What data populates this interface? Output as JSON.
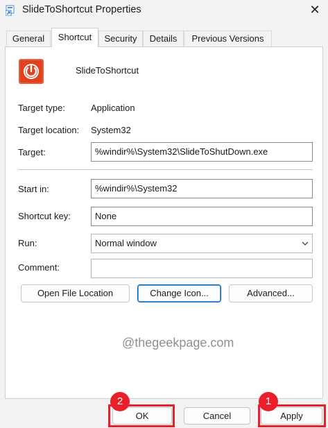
{
  "window": {
    "title": "SlideToShortcut Properties",
    "close_glyph": "✕"
  },
  "tabs": [
    {
      "label": "General"
    },
    {
      "label": "Shortcut"
    },
    {
      "label": "Security"
    },
    {
      "label": "Details"
    },
    {
      "label": "Previous Versions"
    }
  ],
  "shortcut": {
    "name": "SlideToShortcut",
    "icon": "power-icon",
    "target_type_label": "Target type:",
    "target_type": "Application",
    "target_location_label": "Target location:",
    "target_location": "System32",
    "target_label": "Target:",
    "target": "%windir%\\System32\\SlideToShutDown.exe",
    "start_in_label": "Start in:",
    "start_in": "%windir%\\System32",
    "shortcut_key_label": "Shortcut key:",
    "shortcut_key": "None",
    "run_label": "Run:",
    "run": "Normal window",
    "comment_label": "Comment:",
    "comment": ""
  },
  "buttons": {
    "open_file_location": "Open File Location",
    "change_icon": "Change Icon...",
    "advanced": "Advanced...",
    "ok": "OK",
    "cancel": "Cancel",
    "apply": "Apply"
  },
  "watermark": "@thegeekpage.com",
  "annotations": {
    "ok_badge": "2",
    "apply_badge": "1"
  },
  "colors": {
    "accent": "#0067c0",
    "annotation_red": "#e8202a",
    "icon_orange": "#e0421f"
  }
}
